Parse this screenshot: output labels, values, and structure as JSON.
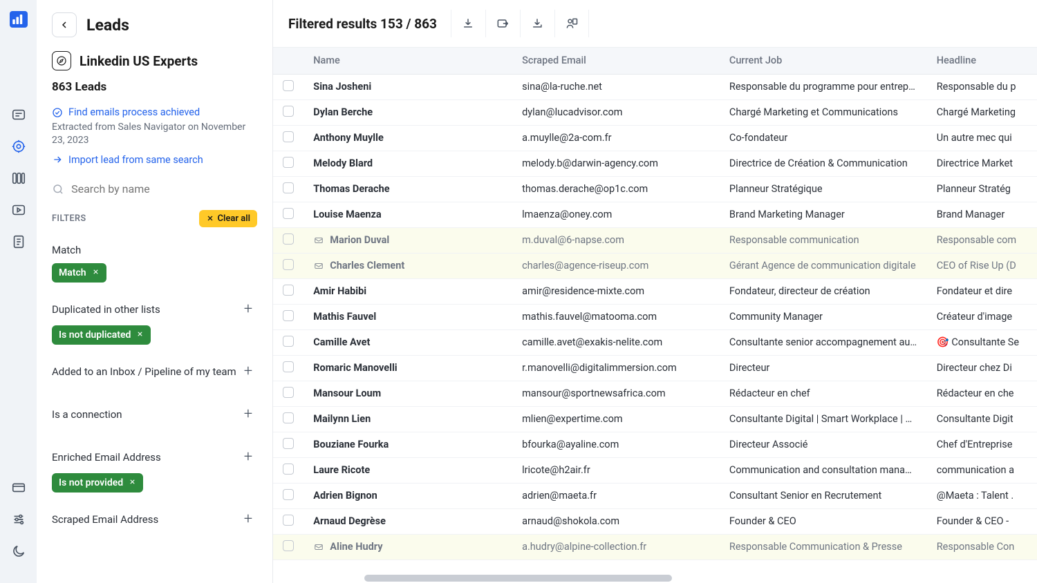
{
  "rail": {
    "items": [
      "message",
      "target",
      "columns",
      "video",
      "document",
      "card",
      "sliders",
      "moon"
    ]
  },
  "sidebar": {
    "page_title": "Leads",
    "list_name": "Linkedin US Experts",
    "leads_count": "863 Leads",
    "status": "Find emails process achieved",
    "status_sub": "Extracted from Sales Navigator on November 23, 2023",
    "import": "Import lead from same search",
    "search_placeholder": "Search by name",
    "filters_label": "FILTERS",
    "clear_all": "Clear all",
    "filters": [
      {
        "title": "Match",
        "chip": "Match",
        "plus": false
      },
      {
        "title": "Duplicated in other lists",
        "chip": "Is not duplicated",
        "plus": true
      },
      {
        "title": "Added to an Inbox / Pipeline of my team",
        "chip": null,
        "plus": true
      },
      {
        "title": "Is a connection",
        "chip": null,
        "plus": true
      },
      {
        "title": "Enriched Email Address",
        "chip": "Is not provided",
        "plus": true
      },
      {
        "title": "Scraped Email Address",
        "chip": null,
        "plus": true
      }
    ]
  },
  "toolbar": {
    "results": "Filtered results 153 / 863"
  },
  "columns": [
    "Name",
    "Scraped Email",
    "Current Job",
    "Headline"
  ],
  "rows": [
    {
      "name": "Sina Josheni",
      "email": "sina@la-ruche.net",
      "job": "Responsable du programme pour entrepre...",
      "headline": "Responsable du p",
      "hl": false,
      "env": false
    },
    {
      "name": "Dylan Berche",
      "email": "dylan@lucadvisor.com",
      "job": "Chargé Marketing et Communications",
      "headline": "Chargé Marketing",
      "hl": false,
      "env": false
    },
    {
      "name": "Anthony Muylle",
      "email": "a.muylle@2a-com.fr",
      "job": "Co-fondateur",
      "headline": "Un autre mec qui",
      "hl": false,
      "env": false
    },
    {
      "name": "Melody Blard",
      "email": "melody.b@darwin-agency.com",
      "job": "Directrice de Création & Communication",
      "headline": "Directrice Market",
      "hl": false,
      "env": false
    },
    {
      "name": "Thomas Derache",
      "email": "thomas.derache@op1c.com",
      "job": "Planneur Stratégique",
      "headline": "Planneur Stratég",
      "hl": false,
      "env": false
    },
    {
      "name": "Louise Maenza",
      "email": "lmaenza@oney.com",
      "job": "Brand Marketing Manager",
      "headline": "Brand Manager",
      "hl": false,
      "env": false
    },
    {
      "name": "Marion Duval",
      "email": "m.duval@6-napse.com",
      "job": "Responsable communication",
      "headline": "Responsable com",
      "hl": true,
      "env": true
    },
    {
      "name": "Charles Clement",
      "email": "charles@agence-riseup.com",
      "job": "Gérant Agence de communication digitale",
      "headline": "CEO of Rise Up (D",
      "hl": true,
      "env": true
    },
    {
      "name": "Amir Habibi",
      "email": "amir@residence-mixte.com",
      "job": "Fondateur, directeur de création",
      "headline": "Fondateur et dire",
      "hl": false,
      "env": false
    },
    {
      "name": "Mathis Fauvel",
      "email": "mathis.fauvel@matooma.com",
      "job": "Community Manager",
      "headline": "Créateur d'image",
      "hl": false,
      "env": false
    },
    {
      "name": "Camille Avet",
      "email": "camille.avet@exakis-nelite.com",
      "job": "Consultante senior accompagnement au c...",
      "headline": "🎯 Consultante Se",
      "hl": false,
      "env": false
    },
    {
      "name": "Romaric Manovelli",
      "email": "r.manovelli@digitalimmersion.com",
      "job": "Directeur",
      "headline": "Directeur chez Di",
      "hl": false,
      "env": false
    },
    {
      "name": "Mansour Loum",
      "email": "mansour@sportnewsafrica.com",
      "job": "Rédacteur en chef",
      "headline": "Rédacteur en che",
      "hl": false,
      "env": false
    },
    {
      "name": "Mailynn Lien",
      "email": "mlien@expertime.com",
      "job": "Consultante Digital | Smart Workplace | Fo...",
      "headline": "Consultante Digit",
      "hl": false,
      "env": false
    },
    {
      "name": "Bouziane Fourka",
      "email": "bfourka@ayaline.com",
      "job": "Directeur Associé",
      "headline": "Chef d'Entreprise",
      "hl": false,
      "env": false
    },
    {
      "name": "Laure Ricote",
      "email": "lricote@h2air.fr",
      "job": "Communication and consultation manager",
      "headline": "communication a",
      "hl": false,
      "env": false
    },
    {
      "name": "Adrien Bignon",
      "email": "adrien@maeta.fr",
      "job": "Consultant Senior en Recrutement",
      "headline": "@Maeta : Talent .",
      "hl": false,
      "env": false
    },
    {
      "name": "Arnaud Degrèse",
      "email": "arnaud@shokola.com",
      "job": "Founder & CEO",
      "headline": "Founder & CEO -",
      "hl": false,
      "env": false
    },
    {
      "name": "Aline Hudry",
      "email": "a.hudry@alpine-collection.fr",
      "job": "Responsable Communication & Presse",
      "headline": "Responsable Con",
      "hl": true,
      "env": true
    }
  ]
}
